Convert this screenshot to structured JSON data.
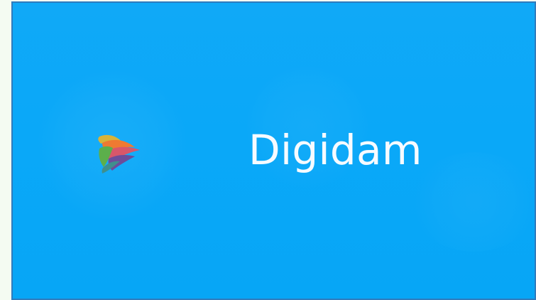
{
  "brand": {
    "name": "Digidam"
  },
  "logo": {
    "icon_name": "bird-logo-icon"
  },
  "colors": {
    "page_background": "#f4fbf2",
    "card_background": "#07a6f6",
    "card_border": "#2f7bbd",
    "brand_text": "#f7fbff",
    "logo_yellow": "#d7b33a",
    "logo_orange": "#ef7a32",
    "logo_red": "#d8576a",
    "logo_purple": "#6d4d9a",
    "logo_green": "#5caf4b",
    "logo_teal": "#3f8f8d"
  }
}
